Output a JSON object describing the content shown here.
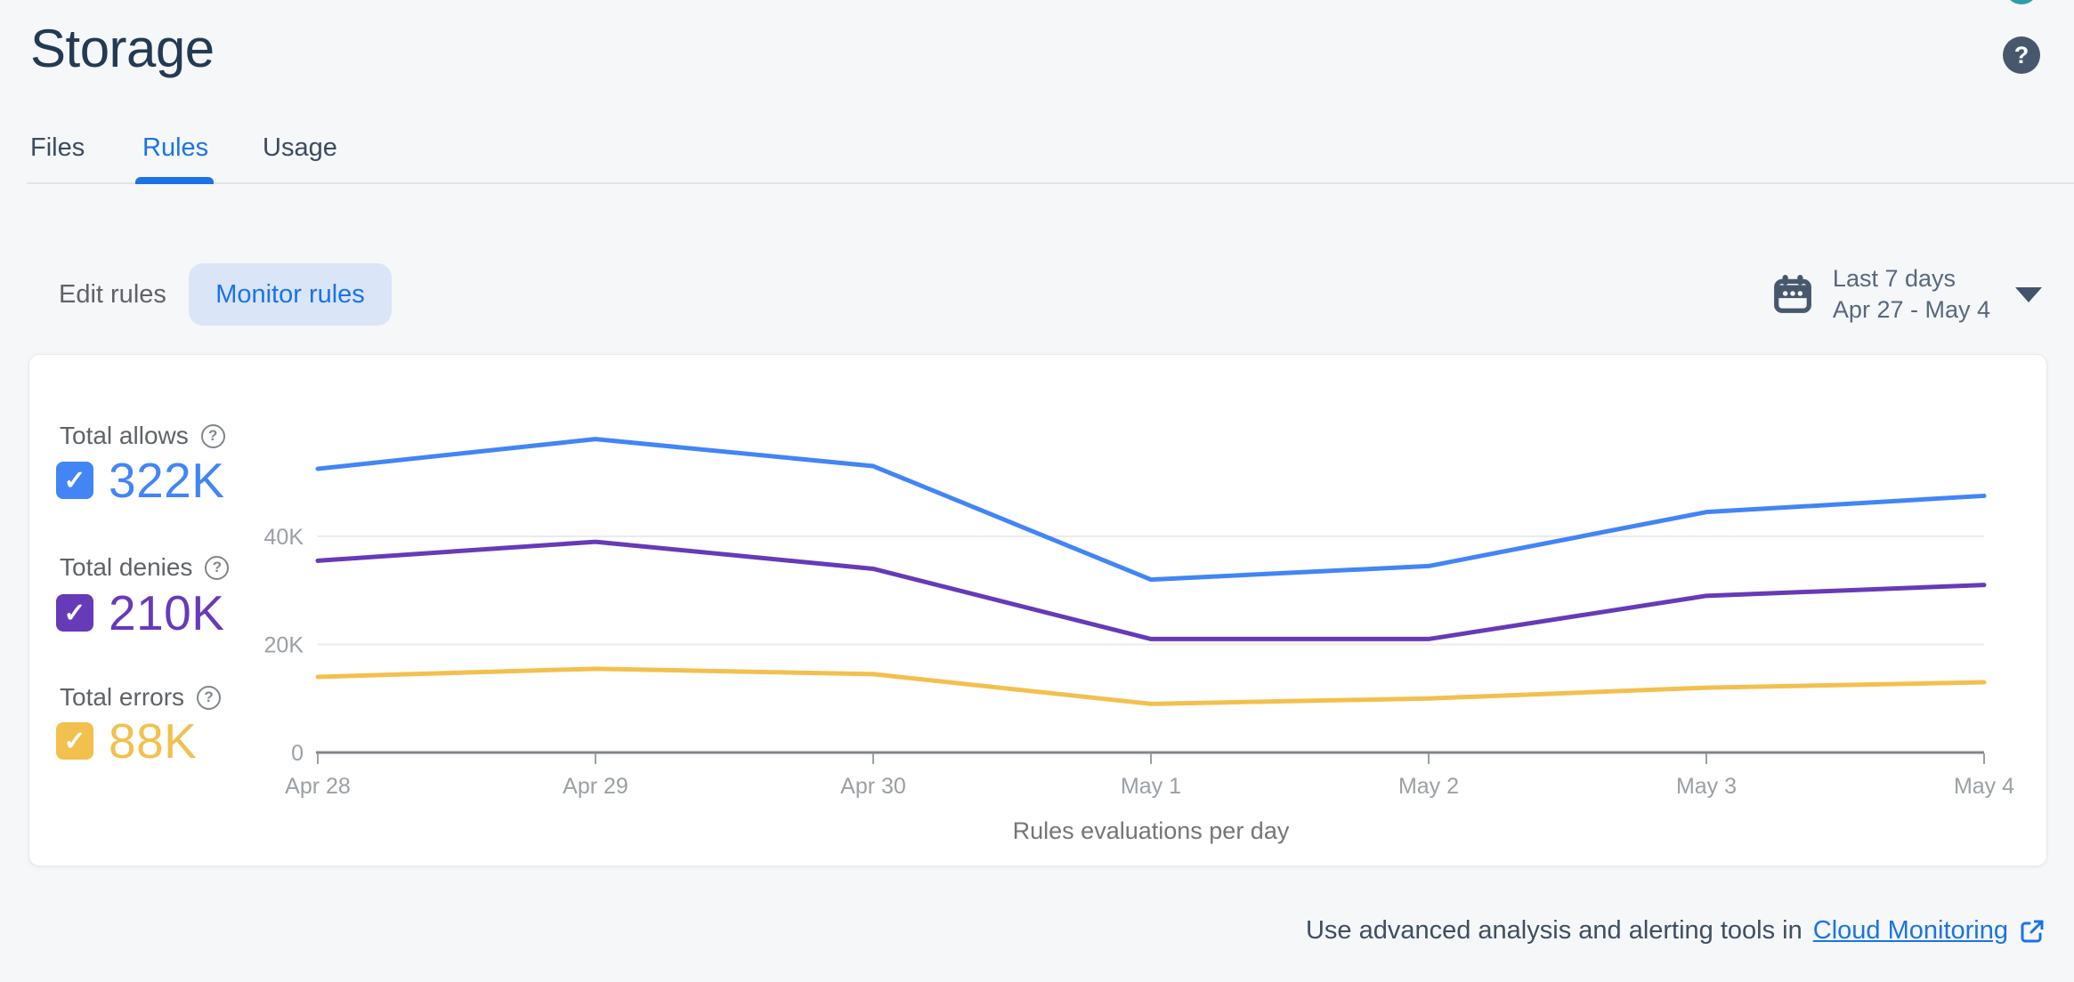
{
  "page": {
    "title": "Storage"
  },
  "header": {
    "help_button_glyph": "?",
    "avatar_color": "#2d9daa",
    "help_button_color": "#47586c"
  },
  "tabs": [
    {
      "label": "Files",
      "active": false
    },
    {
      "label": "Rules",
      "active": true
    },
    {
      "label": "Usage",
      "active": false
    }
  ],
  "controls": {
    "edit_rules_label": "Edit rules",
    "monitor_rules_label": "Monitor rules",
    "date_range": {
      "preset": "Last 7 days",
      "range": "Apr 27 - May 4",
      "calendar_icon": "calendar-icon",
      "caret_icon": "chevron-down-icon"
    }
  },
  "legend": [
    {
      "label": "Total allows",
      "value": "322K",
      "color": "#4285f4",
      "checked": true,
      "help_glyph": "?"
    },
    {
      "label": "Total denies",
      "value": "210K",
      "color": "#673ab7",
      "checked": true,
      "help_glyph": "?"
    },
    {
      "label": "Total errors",
      "value": "88K",
      "color": "#f2c04e",
      "checked": true,
      "help_glyph": "?"
    }
  ],
  "chart_data": {
    "type": "line",
    "title": "Rules evaluations per day",
    "x": [
      "Apr 28",
      "Apr 29",
      "Apr 30",
      "May 1",
      "May 2",
      "May 3",
      "May 4"
    ],
    "series": [
      {
        "name": "Total allows",
        "color": "#4285f4",
        "values_k": [
          52.5,
          58,
          53,
          32,
          34.5,
          44.5,
          47.5
        ]
      },
      {
        "name": "Total denies",
        "color": "#673ab7",
        "values_k": [
          35.5,
          39,
          34,
          21,
          21,
          29,
          31
        ]
      },
      {
        "name": "Total errors",
        "color": "#f2c04e",
        "values_k": [
          14,
          15.5,
          14.5,
          9,
          10,
          12,
          13
        ]
      }
    ],
    "y_ticks": [
      {
        "label": "0",
        "value": 0
      },
      {
        "label": "20K",
        "value": 20
      },
      {
        "label": "40K",
        "value": 40
      }
    ],
    "ylim_k": [
      0,
      60
    ],
    "units": "thousands of evaluations",
    "grid": true,
    "legend_position": "left"
  },
  "footer": {
    "text": "Use advanced analysis and alerting tools in",
    "link_label": "Cloud Monitoring",
    "link_icon": "external-link-icon"
  }
}
